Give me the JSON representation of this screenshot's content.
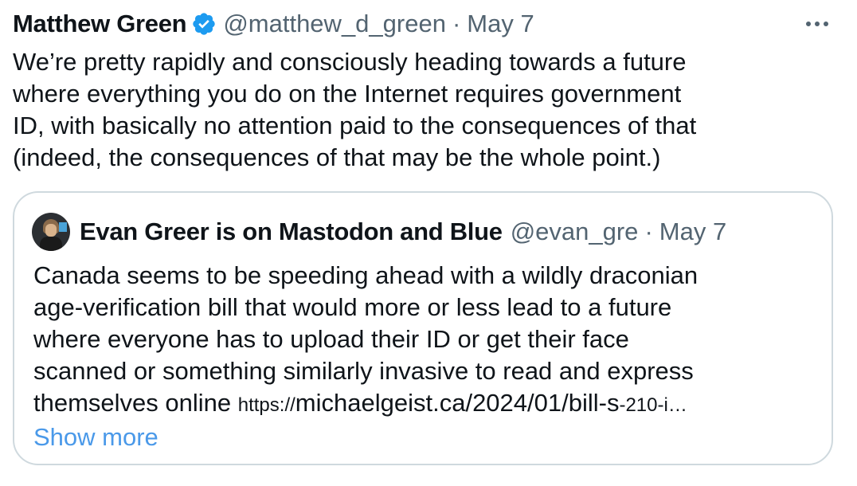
{
  "tweet": {
    "author_name": "Matthew Green",
    "handle": "@matthew_d_green",
    "separator": "·",
    "date": "May 7",
    "more_icon": "ellipsis-icon",
    "verified_icon": "verified-badge-icon",
    "text": "We’re pretty rapidly and consciously heading towards a future\nwhere everything you do on the Internet requires government\nID, with basically no attention paid to the consequences of that\n(indeed, the consequences of that may be the whole point.)"
  },
  "quote": {
    "author_name": "Evan Greer is on Mastodon and Blue",
    "handle": "@evan_gre",
    "separator": "·",
    "date": "May 7",
    "text": "Canada seems to be speeding ahead with a wildly draconian\nage-verification bill that would more or less lead to a future\nwhere everyone has to upload their ID or get their face\nscanned or something similarly invasive to read and express\nthemselves online ",
    "link_proto": "https://",
    "link_main": "michaelgeist.ca/2024/01/bill-s",
    "link_tail": "-210-i…",
    "show_more": "Show more"
  },
  "colors": {
    "text": "#0f1419",
    "secondary": "#536471",
    "verified": "#1d9bf0",
    "link": "#4a99e9",
    "border": "#cfd9de"
  }
}
